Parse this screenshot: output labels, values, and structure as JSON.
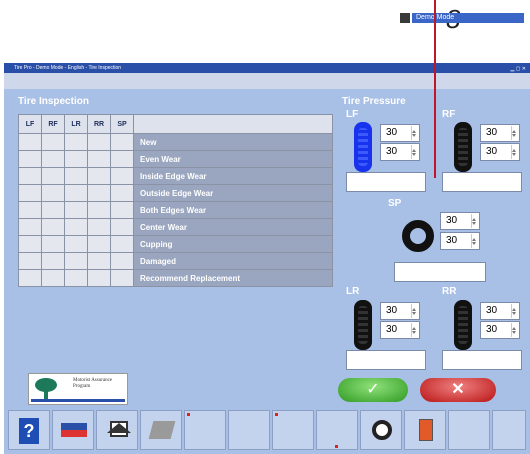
{
  "callout": "8",
  "window": {
    "title": "Tire Pro - Demo Mode - English - Tire Inspection",
    "mode_label": "Demo Mode"
  },
  "inspection": {
    "title": "Tire Inspection",
    "columns": [
      "LF",
      "RF",
      "LR",
      "RR",
      "SP"
    ],
    "rows": [
      "New",
      "Even Wear",
      "Inside Edge Wear",
      "Outside Edge Wear",
      "Both Edges Wear",
      "Center Wear",
      "Cupping",
      "Damaged",
      "Recommend Replacement"
    ]
  },
  "pressure": {
    "title": "Tire Pressure",
    "lf": {
      "label": "LF",
      "p1": "30",
      "p2": "30"
    },
    "rf": {
      "label": "RF",
      "p1": "30",
      "p2": "30"
    },
    "sp": {
      "label": "SP",
      "p1": "30",
      "p2": "30"
    },
    "lr": {
      "label": "LR",
      "p1": "30",
      "p2": "30"
    },
    "rr": {
      "label": "RR",
      "p1": "30",
      "p2": "30"
    }
  },
  "logo_text": "Motorist Assurance Program",
  "buttons": {
    "ok": "✓",
    "cancel": "✕"
  },
  "icons": [
    "help-icon",
    "vehicle-flag-icon",
    "home-icon",
    "tool-icon",
    "wheel-icon",
    "exit-icon"
  ],
  "colors": {
    "accent": "#1833ee",
    "ok": "#2f9a22",
    "cancel": "#b81414",
    "callout_line": "#c0162c"
  }
}
